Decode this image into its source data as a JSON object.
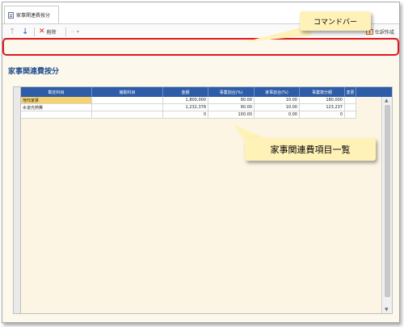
{
  "window": {
    "tab_label": "家事関連費按分"
  },
  "toolbar": {
    "delete_label": "削除",
    "more_label": "⋯ ▾",
    "journal_label": "仕訳作成"
  },
  "page": {
    "title": "家事関連費按分"
  },
  "table": {
    "headers": [
      "勘定科目",
      "補助科目",
      "金額",
      "事業割合(%)",
      "家事割合(%)",
      "事業按分額",
      "変更"
    ],
    "rows": [
      [
        "地代家賃",
        "",
        "1,800,000",
        "90.00",
        "10.00",
        "180,000",
        ""
      ],
      [
        "水道光熱費",
        "",
        "1,232,378",
        "90.00",
        "10.00",
        "123,237",
        ""
      ],
      [
        "",
        "",
        "0",
        "100.00",
        "0.00",
        "0",
        ""
      ]
    ]
  },
  "callouts": {
    "command_bar": "コマンドバー",
    "item_list": "家事関連費項目一覧"
  },
  "colors": {
    "header_blue": "#2d5ca8",
    "highlight_outline": "#e0151d",
    "callout_bg": "#fff2b8",
    "selected_cell": "#f5d272"
  }
}
